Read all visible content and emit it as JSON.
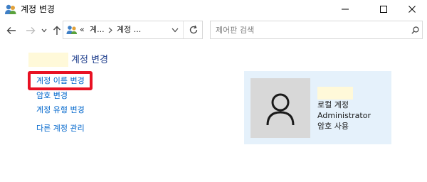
{
  "window": {
    "title": "계정 변경",
    "icon": "user-accounts-icon"
  },
  "nav": {
    "breadcrumbs": [
      "«",
      "계...",
      "계정 ..."
    ],
    "search_placeholder": "제어판 검색"
  },
  "main": {
    "heading": "계정 변경",
    "links": [
      "계정 이름 변경",
      "암호 변경",
      "계정 유형 변경",
      "다른 계정 관리"
    ]
  },
  "account": {
    "name": "",
    "type": "로컬 계정",
    "role": "Administrator",
    "password_status": "암호 사용"
  },
  "colors": {
    "link": "#0066cc",
    "highlight_border": "#e81123",
    "panel_bg": "#e5f1fb",
    "avatar_bg": "#d8d8d8"
  }
}
